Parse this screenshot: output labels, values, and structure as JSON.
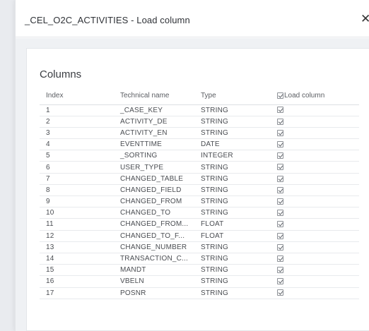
{
  "dialog": {
    "title": "_CEL_O2C_ACTIVITIES - Load column",
    "close_label": "✕"
  },
  "card": {
    "title": "Columns"
  },
  "table": {
    "headers": {
      "index": "Index",
      "technical_name": "Technical name",
      "type": "Type",
      "load_column": "Load column"
    },
    "rows": [
      {
        "index": "1",
        "name": "_CASE_KEY",
        "type": "STRING",
        "load": true
      },
      {
        "index": "2",
        "name": "ACTIVITY_DE",
        "type": "STRING",
        "load": true
      },
      {
        "index": "3",
        "name": "ACTIVITY_EN",
        "type": "STRING",
        "load": true
      },
      {
        "index": "4",
        "name": "EVENTTIME",
        "type": "DATE",
        "load": true
      },
      {
        "index": "5",
        "name": "_SORTING",
        "type": "INTEGER",
        "load": true
      },
      {
        "index": "6",
        "name": "USER_TYPE",
        "type": "STRING",
        "load": true
      },
      {
        "index": "7",
        "name": "CHANGED_TABLE",
        "type": "STRING",
        "load": true
      },
      {
        "index": "8",
        "name": "CHANGED_FIELD",
        "type": "STRING",
        "load": true
      },
      {
        "index": "9",
        "name": "CHANGED_FROM",
        "type": "STRING",
        "load": true
      },
      {
        "index": "10",
        "name": "CHANGED_TO",
        "type": "STRING",
        "load": true
      },
      {
        "index": "11",
        "name": "CHANGED_FROM...",
        "type": "FLOAT",
        "load": true
      },
      {
        "index": "12",
        "name": "CHANGED_TO_F...",
        "type": "FLOAT",
        "load": true
      },
      {
        "index": "13",
        "name": "CHANGE_NUMBER",
        "type": "STRING",
        "load": true
      },
      {
        "index": "14",
        "name": "TRANSACTION_C...",
        "type": "STRING",
        "load": true
      },
      {
        "index": "15",
        "name": "MANDT",
        "type": "STRING",
        "load": true
      },
      {
        "index": "16",
        "name": "VBELN",
        "type": "STRING",
        "load": true
      },
      {
        "index": "17",
        "name": "POSNR",
        "type": "STRING",
        "load": true
      }
    ]
  }
}
